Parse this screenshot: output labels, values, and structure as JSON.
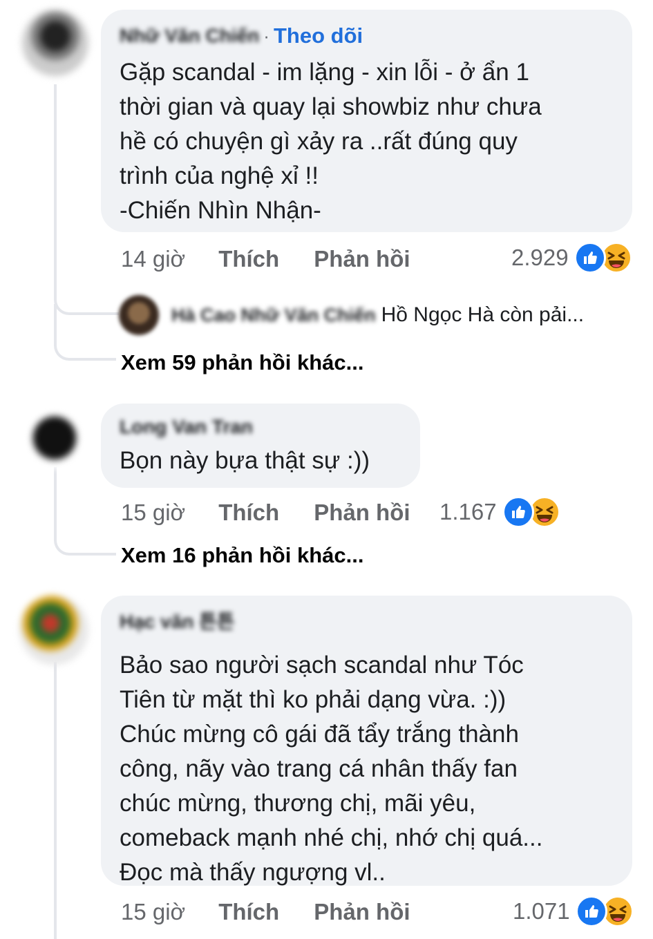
{
  "comments": [
    {
      "author": "Nhữ Văn Chiến",
      "follow_label": "Theo dõi",
      "separator": "·",
      "text": "Gặp scandal - im lặng - xin lỗi - ở ẩn 1\nthời gian và quay lại showbiz như chưa\nhề có chuyện gì xảy ra ..rất đúng quy\ntrình của nghệ xỉ !!\n-Chiến Nhìn Nhận-",
      "time": "14 giờ",
      "like_label": "Thích",
      "reply_label": "Phản hồi",
      "reaction_count": "2.929",
      "reply_preview": {
        "author": "Hà Cao Nhữ Văn Chiến",
        "snippet": "Hồ Ngọc Hà còn pải..."
      },
      "more_replies": "Xem 59 phản hồi khác..."
    },
    {
      "author": "Long Van Tran",
      "text": "Bọn này bựa thật sự :))",
      "time": "15 giờ",
      "like_label": "Thích",
      "reply_label": "Phản hồi",
      "reaction_count": "1.167",
      "more_replies": "Xem 16 phản hồi khác..."
    },
    {
      "author": "Hạc văn 튼튼",
      "text": "Bảo sao người sạch scandal như Tóc\nTiên từ mặt thì ko phải dạng vừa. :))\nChúc mừng cô gái đã tẩy trắng thành\ncông, nãy vào trang cá nhân thấy fan\nchúc mừng, thương chị, mãi yêu,\ncomeback mạnh nhé chị, nhớ chị quá...\nĐọc mà thấy ngượng vl..",
      "time": "15 giờ",
      "like_label": "Thích",
      "reply_label": "Phản hồi",
      "reaction_count": "1.071"
    }
  ],
  "icons": {
    "like": "like-reaction-icon",
    "haha": "haha-reaction-icon"
  },
  "colors": {
    "bubble": "#f0f2f5",
    "link_blue": "#216fdb",
    "like_blue": "#1877f2",
    "haha_yellow": "#f7b125",
    "meta_grey": "#65676b"
  }
}
